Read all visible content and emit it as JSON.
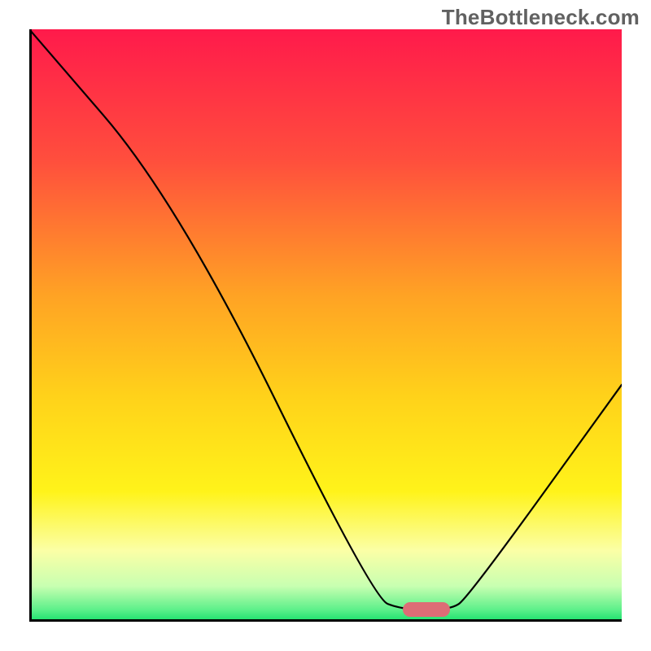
{
  "watermark": "TheBottleneck.com",
  "chart_data": {
    "type": "line",
    "title": "",
    "xlabel": "",
    "ylabel": "",
    "xlim": [
      0,
      100
    ],
    "ylim": [
      0,
      100
    ],
    "grid": false,
    "legend": false,
    "background_gradient": {
      "direction": "vertical",
      "stops": [
        {
          "pos": 0.0,
          "color": "#ff1a4b"
        },
        {
          "pos": 0.22,
          "color": "#ff4e3d"
        },
        {
          "pos": 0.45,
          "color": "#ffa324"
        },
        {
          "pos": 0.62,
          "color": "#ffd21a"
        },
        {
          "pos": 0.78,
          "color": "#fff31a"
        },
        {
          "pos": 0.88,
          "color": "#fbffa6"
        },
        {
          "pos": 0.94,
          "color": "#c8ffb1"
        },
        {
          "pos": 0.98,
          "color": "#5cf08a"
        },
        {
          "pos": 1.0,
          "color": "#18e06c"
        }
      ]
    },
    "series": [
      {
        "name": "bottleneck-curve",
        "color": "#000000",
        "points": [
          {
            "x": 0,
            "y": 100
          },
          {
            "x": 25,
            "y": 71
          },
          {
            "x": 58,
            "y": 4
          },
          {
            "x": 63,
            "y": 2
          },
          {
            "x": 71,
            "y": 2
          },
          {
            "x": 74,
            "y": 4
          },
          {
            "x": 100,
            "y": 40
          }
        ]
      }
    ],
    "marker": {
      "name": "optimal-range",
      "color": "#dd6d76",
      "x_start": 63,
      "x_end": 71,
      "y": 2
    }
  }
}
